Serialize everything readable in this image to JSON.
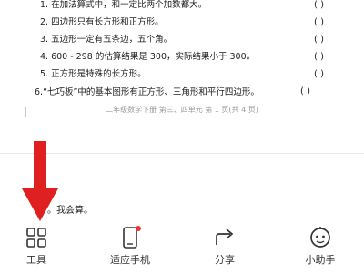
{
  "document": {
    "questions": [
      {
        "text": "1. 在加法算式中，和一定比两个加数都大。",
        "paren": "(          )"
      },
      {
        "text": "2. 四边形只有长方形和正方形。",
        "paren": "(          )"
      },
      {
        "text": "3. 五边形一定有五条边，五个角。",
        "paren": "(          )"
      },
      {
        "text": "4. 600 - 298 的估算结果是 300，实际结果小于 300。",
        "paren": "(          )"
      },
      {
        "text": "5. 正方形是特殊的长方形。",
        "paren": "(          )"
      },
      {
        "text": "6.“七巧板”中的基本图形有正方形、三角形和平行四边形。",
        "paren": "(          )"
      }
    ],
    "footer": "二年级数学下册      第三、四单元      第 1 页(共 4 页)"
  },
  "section_heading": "。我会算。",
  "toolbar": {
    "items": [
      {
        "label": "工具",
        "icon": "grid-icon"
      },
      {
        "label": "适应手机",
        "icon": "phone-fit-icon"
      },
      {
        "label": "分享",
        "icon": "share-icon"
      },
      {
        "label": "小助手",
        "icon": "assistant-icon"
      }
    ],
    "notification_dot_color": "#e53935"
  },
  "overlay": {
    "arrow_color": "#e02020"
  }
}
